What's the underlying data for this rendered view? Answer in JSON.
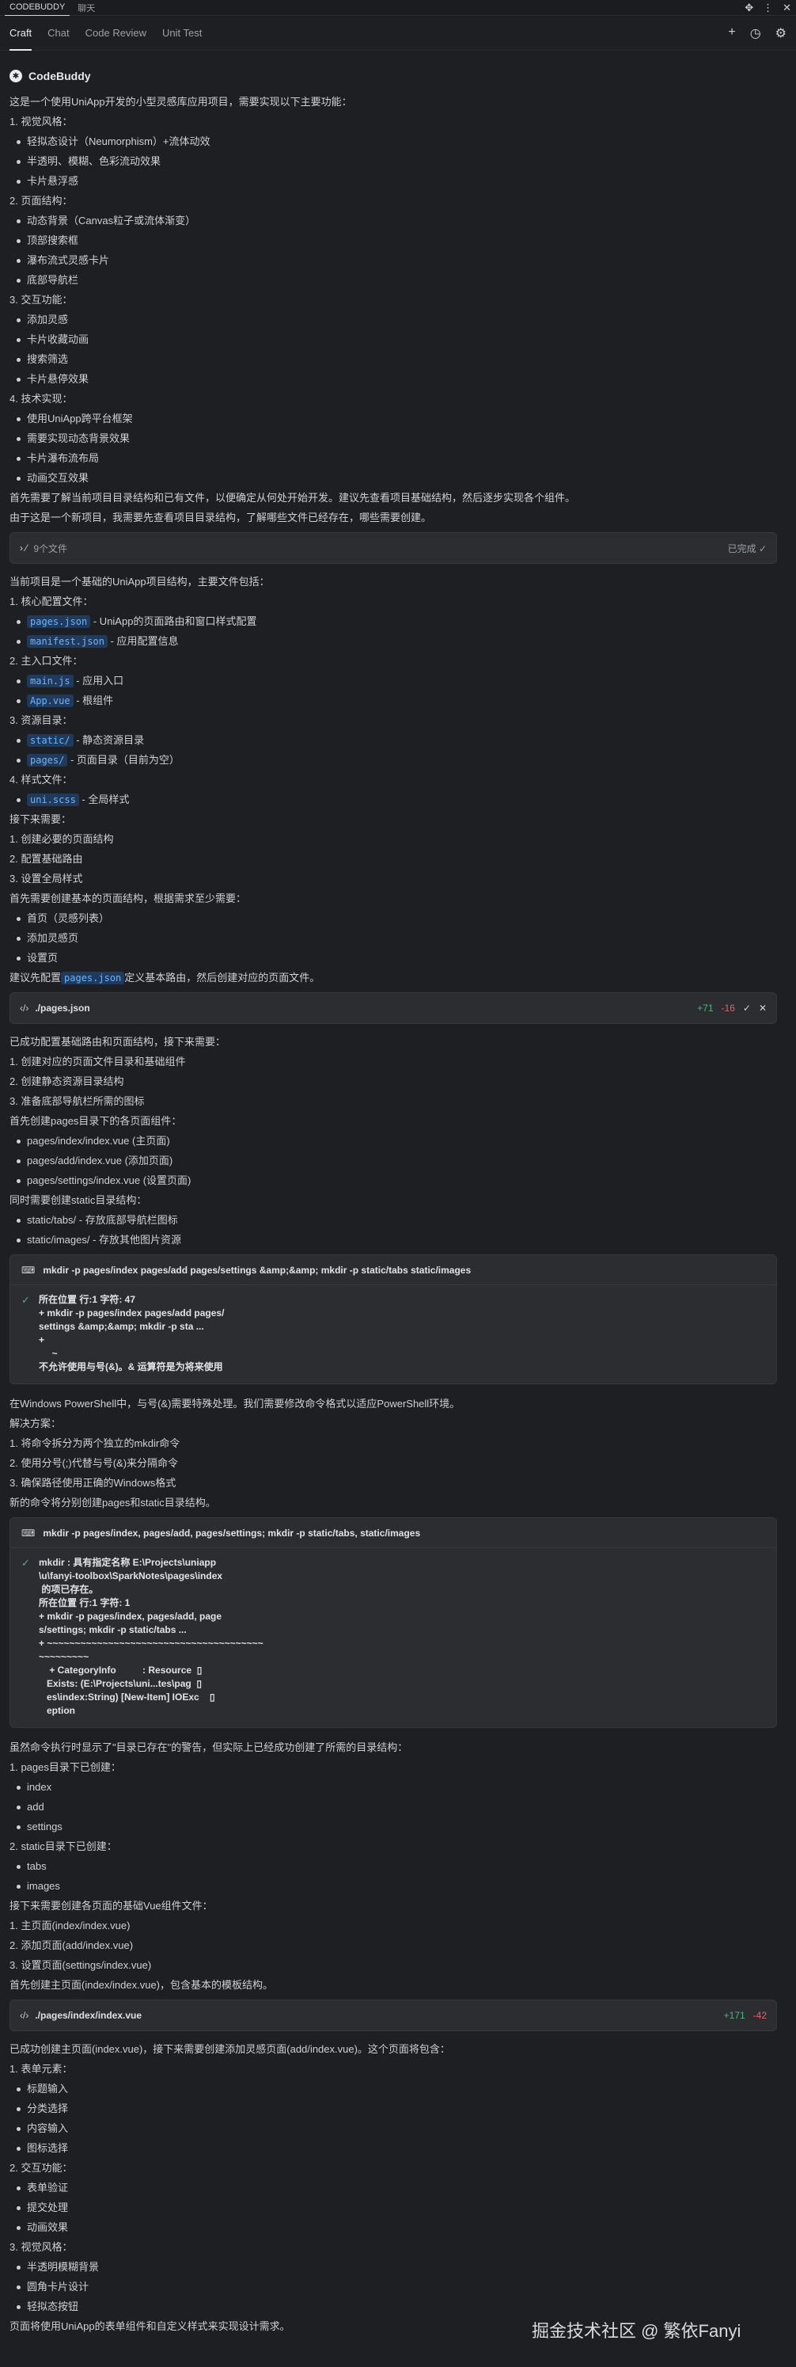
{
  "app": {
    "name": "CODEBUDDY",
    "tab2": "聊天",
    "window_controls": {
      "move": "✥",
      "more": "⋮",
      "close": "✕"
    }
  },
  "tabs": [
    {
      "label": "Craft"
    },
    {
      "label": "Chat"
    },
    {
      "label": "Code Review"
    },
    {
      "label": "Unit Test"
    }
  ],
  "tab_actions": {
    "new": "+",
    "history": "◷",
    "settings": "⚙"
  },
  "brand": {
    "logo": "✱",
    "name": "CodeBuddy"
  },
  "sec1": [
    "这是一个使用UniApp开发的小型灵感库应用项目，需要实现以下主要功能：",
    "1. 视觉风格：",
    "• 轻拟态设计（Neumorphism）+流体动效",
    "• 半透明、模糊、色彩流动效果",
    "• 卡片悬浮感",
    "2. 页面结构：",
    "• 动态背景（Canvas粒子或流体渐变）",
    "• 顶部搜索框",
    "• 瀑布流式灵感卡片",
    "• 底部导航栏",
    "3. 交互功能：",
    "• 添加灵感",
    "• 卡片收藏动画",
    "• 搜索筛选",
    "• 卡片悬停效果",
    "4. 技术实现：",
    "• 使用UniApp跨平台框架",
    "• 需要实现动态背景效果",
    "• 卡片瀑布流布局",
    "• 动画交互效果",
    "首先需要了解当前项目目录结构和已有文件，以便确定从何处开始开发。建议先查看项目基础结构，然后逐步实现各个组件。",
    "由于这是一个新项目，我需要先查看项目目录结构，了解哪些文件已经存在，哪些需要创建。"
  ],
  "card1": {
    "icon": "› ⁄",
    "title": "9个文件",
    "status": "已完成 ✓"
  },
  "sec2": {
    "intro": "当前项目是一个基础的UniApp项目结构，主要文件包括：",
    "g1": "1. 核心配置文件：",
    "pages_json": "pages.json",
    "pages_json_desc": " - UniApp的页面路由和窗口样式配置",
    "manifest_json": "manifest.json",
    "manifest_json_desc": " - 应用配置信息",
    "g2": "2. 主入口文件：",
    "main_js": "main.js",
    "main_js_desc": " - 应用入口",
    "app_vue": "App.vue",
    "app_vue_desc": " - 根组件",
    "g3": "3. 资源目录：",
    "static": "static/",
    "static_desc": " - 静态资源目录",
    "pages": "pages/",
    "pages_desc": " - 页面目录（目前为空）",
    "g4": "4. 样式文件：",
    "uni_scss": "uni.scss",
    "uni_scss_desc": " - 全局样式",
    "next": "接下来需要：",
    "n1": "1. 创建必要的页面结构",
    "n2": "2. 配置基础路由",
    "n3": "3. 设置全局样式",
    "base": "首先需要创建基本的页面结构，根据需求至少需要：",
    "b1": "• 首页（灵感列表）",
    "b2": "• 添加灵感页",
    "b3": "• 设置页",
    "suggest_pre": "建议先配置",
    "suggest_code": "pages.json",
    "suggest_post": "定义基本路由，然后创建对应的页面文件。"
  },
  "card2": {
    "icon": "‹/›",
    "title": "./pages.json",
    "plus": "+71",
    "minus": "-16",
    "accept": "✓",
    "reject": "✕"
  },
  "sec3": [
    "已成功配置基础路由和页面结构，接下来需要：",
    "1. 创建对应的页面文件目录和基础组件",
    "2. 创建静态资源目录结构",
    "3. 准备底部导航栏所需的图标",
    "首先创建pages目录下的各页面组件：",
    "• pages/index/index.vue (主页面)",
    "• pages/add/index.vue (添加页面)",
    "• pages/settings/index.vue (设置页面)",
    "同时需要创建static目录结构：",
    "• static/tabs/ - 存放底部导航栏图标",
    "• static/images/ - 存放其他图片资源"
  ],
  "term1": {
    "icon": "⌨",
    "cmd": "mkdir -p pages/index pages/add pages/settings &amp;&amp; mkdir -p static/tabs static/images",
    "check": "✓",
    "out": [
      "所在位置 行:1 字符: 47",
      "+ mkdir -p pages/index pages/add pages/",
      "settings &amp;&amp; mkdir -p sta ...",
      "+",
      "     ~",
      "不允许使用与号(&)。& 运算符是为将来使用"
    ]
  },
  "sec4": [
    "在Windows PowerShell中，与号(&)需要特殊处理。我们需要修改命令格式以适应PowerShell环境。",
    "解决方案：",
    "1. 将命令拆分为两个独立的mkdir命令",
    "2. 使用分号(;)代替与号(&)来分隔命令",
    "3. 确保路径使用正确的Windows格式",
    "新的命令将分别创建pages和static目录结构。"
  ],
  "term2": {
    "icon": "⌨",
    "cmd": "mkdir -p pages/index, pages/add, pages/settings; mkdir -p static/tabs, static/images",
    "check": "✓",
    "out": [
      "mkdir : 具有指定名称 E:\\Projects\\uniapp",
      "\\u\\fanyi-toolbox\\SparkNotes\\pages\\index",
      " 的项已存在。",
      "所在位置 行:1 字符: 1",
      "+ mkdir -p pages/index, pages/add, page",
      "s/settings; mkdir -p static/tabs ...",
      "+ ~~~~~~~~~~~~~~~~~~~~~~~~~~~~~~~~~~~~~~~",
      "~~~~~~~~~",
      "    + CategoryInfo          : Resource  ▯",
      "   Exists: (E:\\Projects\\uni...tes\\pag  ▯",
      "   es\\index:String) [New-Item] IOExc    ▯",
      "   eption"
    ]
  },
  "sec5": [
    "虽然命令执行时显示了\"目录已存在\"的警告，但实际上已经成功创建了所需的目录结构：",
    "1. pages目录下已创建：",
    "• index",
    "• add",
    "• settings",
    "2. static目录下已创建：",
    "• tabs",
    "• images",
    "接下来需要创建各页面的基础Vue组件文件：",
    "1. 主页面(index/index.vue)",
    "2. 添加页面(add/index.vue)",
    "3. 设置页面(settings/index.vue)",
    "首先创建主页面(index/index.vue)，包含基本的模板结构。"
  ],
  "card3": {
    "icon": "‹/›",
    "title": "./pages/index/index.vue",
    "plus": "+171",
    "minus": "-42"
  },
  "sec6": [
    "已成功创建主页面(index.vue)，接下来需要创建添加灵感页面(add/index.vue)。这个页面将包含：",
    "1. 表单元素：",
    "• 标题输入",
    "• 分类选择",
    "• 内容输入",
    "• 图标选择",
    "2. 交互功能：",
    "• 表单验证",
    "• 提交处理",
    "• 动画效果",
    "3. 视觉风格：",
    "• 半透明模糊背景",
    "• 圆角卡片设计",
    "• 轻拟态按钮",
    "页面将使用UniApp的表单组件和自定义样式来实现设计需求。"
  ],
  "watermark": "掘金技术社区 @ 繁依Fanyi"
}
